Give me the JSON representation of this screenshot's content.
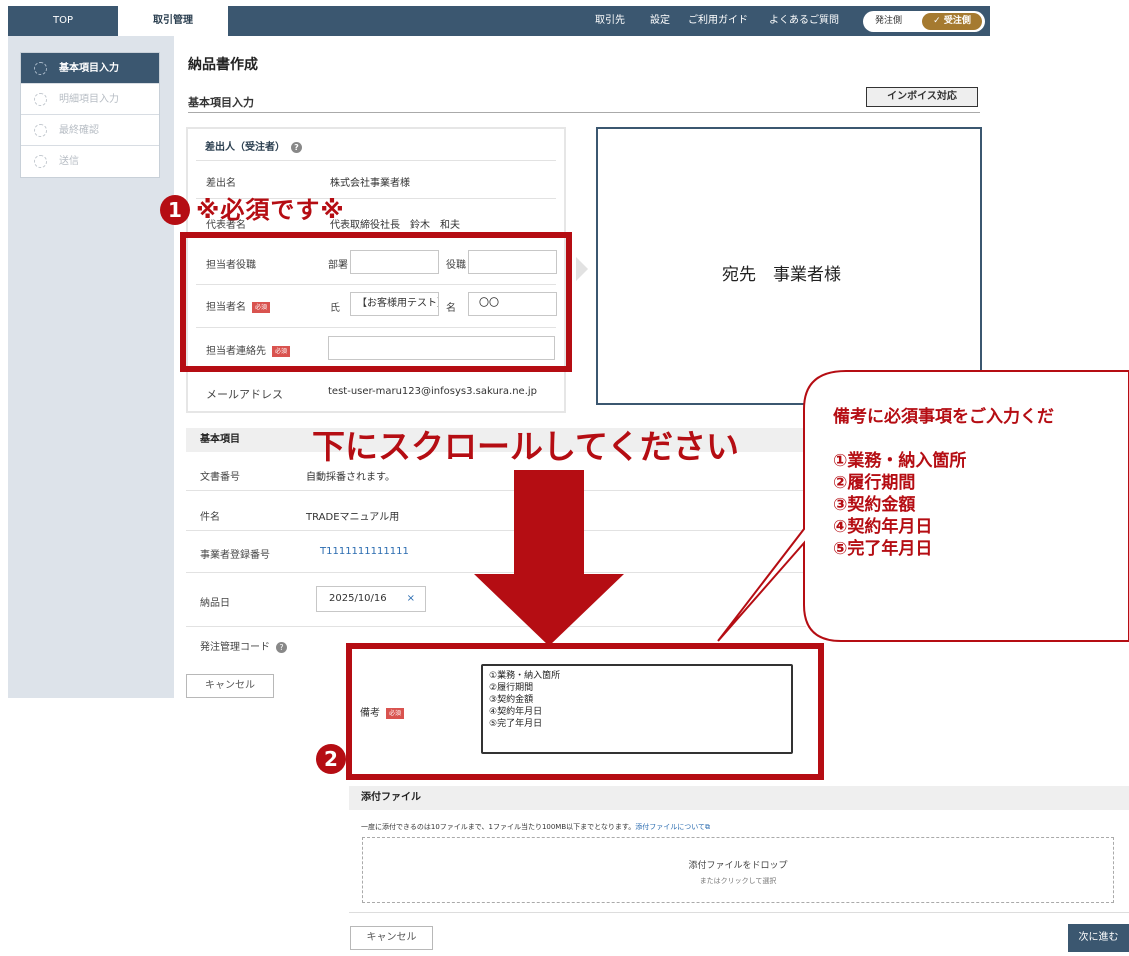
{
  "nav": {
    "tabs": [
      "TOP",
      "取引管理"
    ],
    "links": [
      "取引先",
      "設定",
      "ご利用ガイド",
      "よくあるご質問"
    ],
    "toggle": {
      "off_label": "発注側",
      "on_label": "受注側",
      "check": "✓"
    }
  },
  "steps": [
    "基本項目入力",
    "明細項目入力",
    "最終確認",
    "送信"
  ],
  "page": {
    "title": "納品書作成",
    "section": "基本項目入力",
    "invoice_badge": "インボイス対応"
  },
  "sender": {
    "heading": "差出人（受注者）",
    "help": "?",
    "name_label": "差出名",
    "name_value": "株式会社事業者様",
    "rep_label": "代表者名",
    "rep_value": "代表取締役社長　鈴木　和夫",
    "role_label": "担当者役職",
    "dept_label": "部署",
    "title_label": "役職",
    "person_label": "担当者名",
    "sei_label": "氏",
    "sei_value": "【お客様用テスト】",
    "mei_label": "名",
    "mei_value": "〇〇",
    "contact_label": "担当者連絡先",
    "required": "必須",
    "email_label": "メールアドレス",
    "email_value": "test-user-maru123@infosys3.sakura.ne.jp"
  },
  "recipient": {
    "text": "宛先　事業者様"
  },
  "basic": {
    "heading": "基本項目",
    "rows": [
      {
        "label": "文書番号",
        "value": "自動採番されます。"
      },
      {
        "label": "件名",
        "value": "TRADEマニュアル用"
      },
      {
        "label": "事業者登録番号",
        "value": "T1111111111111"
      },
      {
        "label": "納品日",
        "value": "2025/10/16",
        "clear": "×"
      },
      {
        "label": "発注管理コード",
        "value": ""
      }
    ]
  },
  "buttons": {
    "cancel": "キャンセル",
    "next": "次に進む"
  },
  "annotations": {
    "n1": "1",
    "n2": "2",
    "required_note": "※必須です※",
    "scroll_note": "下にスクロールしてください",
    "callout_title": "備考に必須事項をご入力くだ",
    "callout_items": [
      "①業務・納入箇所",
      "②履行期間",
      "③契約金額",
      "④契約年月日",
      "⑤完了年月日"
    ]
  },
  "remarks": {
    "label": "備考",
    "lines": [
      "①業務・納入箇所",
      "②履行期間",
      "③契約金額",
      "④契約年月日",
      "⑤完了年月日"
    ]
  },
  "attachments": {
    "heading": "添付ファイル",
    "note": "一度に添付できるのは10ファイルまで、1ファイル当たり100MB以下までとなります。",
    "link": "添付ファイルについて",
    "link_icon": "⧉",
    "drop_main": "添付ファイルをドロップ",
    "drop_sub": "またはクリックして選択"
  },
  "colors": {
    "accent_red": "#b50d13",
    "nav": "#3b5770",
    "toggle_active": "#a57a30"
  }
}
